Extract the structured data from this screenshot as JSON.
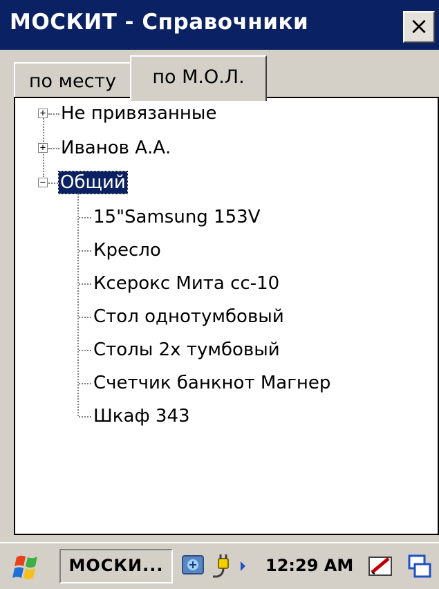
{
  "window": {
    "title": "МОСКИТ - Справочники",
    "close_label": "×"
  },
  "tabs": [
    {
      "label": "по месту",
      "active": false
    },
    {
      "label": "по М.О.Л.",
      "active": true
    }
  ],
  "tree": {
    "nodes": [
      {
        "label": "Не привязанные",
        "expander": "+",
        "expanded": false
      },
      {
        "label": "Иванов А.А.",
        "expander": "+",
        "expanded": false
      },
      {
        "label": "Общий",
        "expander": "−",
        "expanded": true,
        "selected": true,
        "children": [
          "15\"Samsung 153V",
          "Кресло",
          "Ксерокс Мита сс-10",
          "Стол однотумбовый",
          "Столы 2х тумбовый",
          "Счетчик банкнот Магнер",
          "Шкаф 343"
        ]
      }
    ]
  },
  "taskbar": {
    "task_label": "МОСКИ...",
    "clock": "12:29 AM",
    "icons": [
      "start-flag-icon",
      "network-icon",
      "power-plug-icon",
      "input-pen-icon",
      "windows-switch-icon"
    ]
  },
  "colors": {
    "titlebar": "#0a2163",
    "selection": "#0a2163",
    "chrome": "#d4d0c8"
  }
}
